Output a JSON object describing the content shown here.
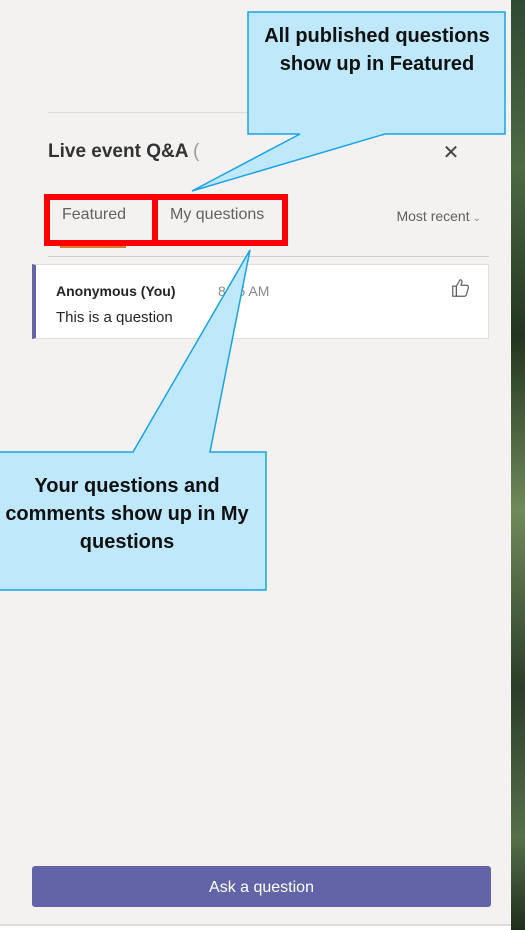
{
  "panel": {
    "title": "Live event Q&A",
    "title_suffix": "(",
    "close_icon": "close-icon"
  },
  "tabs": [
    {
      "label": "Featured",
      "selected": true
    },
    {
      "label": "My questions",
      "selected": false
    }
  ],
  "sort": {
    "label": "Most recent",
    "icon": "chevron-down-icon"
  },
  "question": {
    "author": "Anonymous (You)",
    "time": "8:15 AM",
    "text": "This is a question",
    "like_icon": "thumbs-up-icon"
  },
  "ask_button": {
    "label": "Ask a question"
  },
  "annotations": {
    "callout_1": "All published questions show up in Featured",
    "callout_2": "Your questions and comments show up in My questions"
  },
  "colors": {
    "accent": "#6264a7",
    "highlight": "#ff0000",
    "callout_fill": "#bfe8fb",
    "callout_stroke": "#1aa3e6",
    "tab_underline": "#e07a2a"
  }
}
